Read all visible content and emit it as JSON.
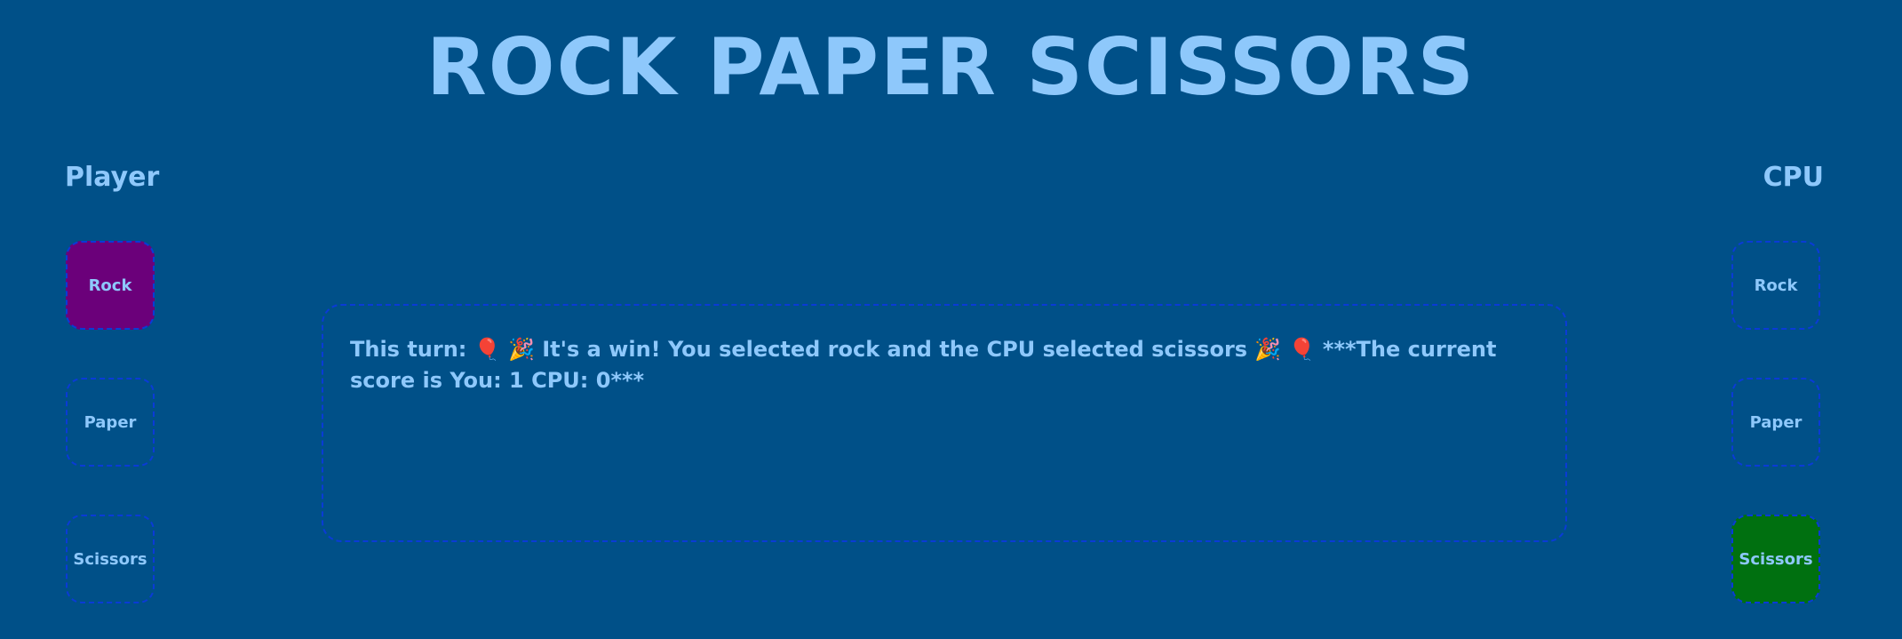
{
  "title": "ROCK PAPER SCISSORS",
  "player": {
    "label": "Player",
    "choices": [
      "Rock",
      "Paper",
      "Scissors"
    ],
    "selected": "Rock"
  },
  "cpu": {
    "label": "CPU",
    "choices": [
      "Rock",
      "Paper",
      "Scissors"
    ],
    "selected": "Scissors"
  },
  "result": {
    "text": "This turn: 🎈 🎉 It's a win! You selected rock and the CPU selected scissors 🎉 🎈 ***The current score is You: 1 CPU: 0***"
  },
  "colors": {
    "background": "#005088",
    "text": "#8ec8fb",
    "border": "#0a3bd6",
    "player_selected": "#6b007a",
    "cpu_selected": "#007010"
  }
}
